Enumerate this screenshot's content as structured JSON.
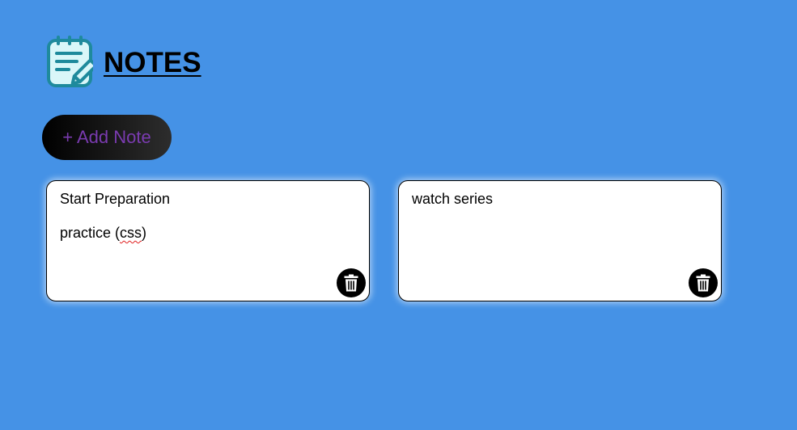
{
  "header": {
    "title": "NOTES",
    "icon": "notepad-pencil-icon"
  },
  "toolbar": {
    "add_note_label": "+ Add Note"
  },
  "notes": [
    {
      "lines": [
        "Start Preparation",
        "practice (",
        "css",
        ")"
      ],
      "delete_icon": "trash-icon"
    },
    {
      "lines": [
        "watch series"
      ],
      "delete_icon": "trash-icon"
    }
  ],
  "colors": {
    "background": "#4592e6",
    "add_button_text": "#7a3bb0",
    "icon_stroke": "#1e8a9c",
    "icon_fill": "#d9f7f9"
  }
}
